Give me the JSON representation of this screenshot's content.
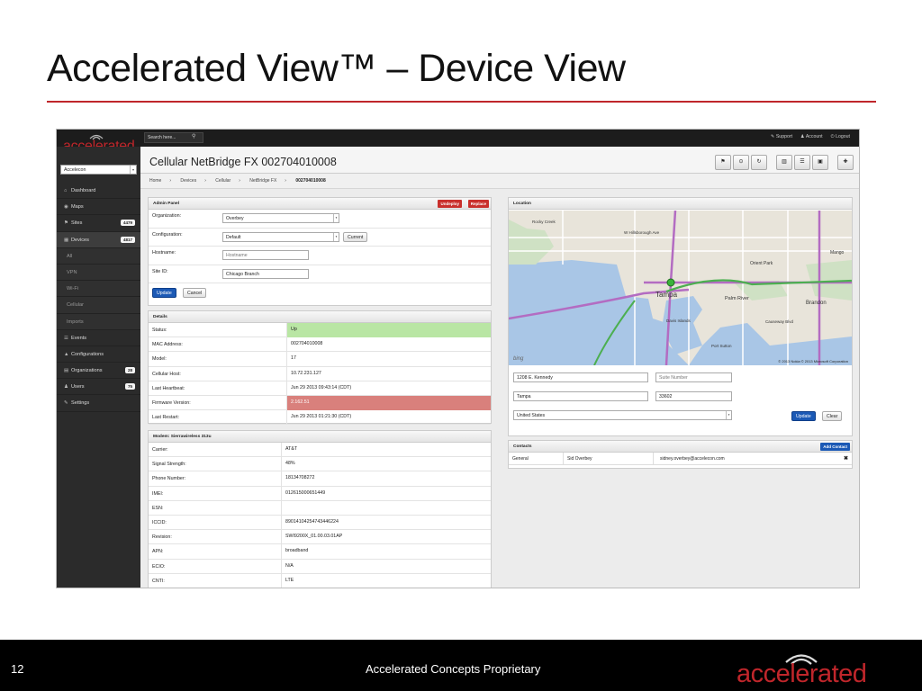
{
  "slide": {
    "title": "Accelerated View™ – Device View",
    "page_number": "12",
    "footer_text": "Accelerated Concepts Proprietary",
    "logo_text": "accelerated",
    "accent_color": "#c0262b"
  },
  "app": {
    "brand": "accelerated",
    "search_placeholder": "Search here...",
    "top_links": [
      "Support",
      "Account",
      "Logout"
    ],
    "org_select": "Accelecon",
    "nav": [
      {
        "label": "Dashboard",
        "icon": "home-icon",
        "glyph": "⌂",
        "badge": ""
      },
      {
        "label": "Maps",
        "icon": "map-pin-icon",
        "glyph": "◉",
        "badge": ""
      },
      {
        "label": "Sites",
        "icon": "flag-icon",
        "glyph": "⚑",
        "badge": "4479"
      },
      {
        "label": "Devices",
        "icon": "device-icon",
        "glyph": "▦",
        "badge": "4817",
        "active": true
      },
      {
        "label": "All",
        "sub": true,
        "badge": ""
      },
      {
        "label": "VPN",
        "sub": true,
        "badge": ""
      },
      {
        "label": "Wi-Fi",
        "sub": true,
        "badge": ""
      },
      {
        "label": "Cellular",
        "sub": true,
        "badge": ""
      },
      {
        "label": "Imports",
        "sub": true,
        "badge": ""
      },
      {
        "label": "Events",
        "icon": "list-icon",
        "glyph": "☰",
        "badge": ""
      },
      {
        "label": "Configurations",
        "icon": "flask-icon",
        "glyph": "▲",
        "badge": ""
      },
      {
        "label": "Organizations",
        "icon": "org-icon",
        "glyph": "▤",
        "badge": "28"
      },
      {
        "label": "Users",
        "icon": "user-icon",
        "glyph": "♟",
        "badge": "75"
      },
      {
        "label": "Settings",
        "icon": "wrench-icon",
        "glyph": "✎",
        "badge": ""
      }
    ],
    "page_title": "Cellular NetBridge FX 002704010008",
    "breadcrumbs": [
      "Home",
      "Devices",
      "Cellular",
      "NetBridge FX",
      "002704010008"
    ],
    "admin": {
      "title": "Admin Panel",
      "undeploy": "Undeploy",
      "replace": "Replace",
      "organization_label": "Organization:",
      "organization_value": "Overbey",
      "configuration_label": "Configuration:",
      "configuration_value": "Default",
      "current_btn": "Current",
      "hostname_label": "Hostname:",
      "hostname_placeholder": "Hostname",
      "siteid_label": "Site ID:",
      "siteid_value": "Chicago Branch",
      "update": "Update",
      "cancel": "Cancel"
    },
    "details": {
      "title": "Details",
      "rows": [
        {
          "k": "Status:",
          "v": "Up",
          "state": "good"
        },
        {
          "k": "MAC Address:",
          "v": "002704010008"
        },
        {
          "k": "Model:",
          "v": "17"
        },
        {
          "k": "Cellular Host:",
          "v": "10.72.231.127"
        },
        {
          "k": "Last Heartbeat:",
          "v": "Jun 29 2013 09:43:14 (CDT)"
        },
        {
          "k": "Firmware Version:",
          "v": "2.162.51",
          "state": "bad"
        },
        {
          "k": "Last Restart:",
          "v": "Jun 29 2013 01:21:30 (CDT)"
        }
      ]
    },
    "modem": {
      "title": "Modem: Sierrawireless 313u",
      "rows": [
        {
          "k": "Carrier:",
          "v": "AT&T"
        },
        {
          "k": "Signal Strength:",
          "v": "48%"
        },
        {
          "k": "Phone Number:",
          "v": "18134708272"
        },
        {
          "k": "IMEI:",
          "v": "012615000651449"
        },
        {
          "k": "ESN:",
          "v": ""
        },
        {
          "k": "ICCID:",
          "v": "89014104254743446224"
        },
        {
          "k": "Revision:",
          "v": "SWI9200X_01.00.03.01AP"
        },
        {
          "k": "APN:",
          "v": "broadband"
        },
        {
          "k": "ECIO:",
          "v": "N/A"
        },
        {
          "k": "CNTI:",
          "v": "LTE"
        }
      ]
    },
    "location": {
      "title": "Location",
      "address": "1208 E. Kennedy",
      "suite_placeholder": "Suite Number",
      "city": "Tampa",
      "zip": "33602",
      "country": "United States",
      "update": "Update",
      "clear": "Clear",
      "map_labels": [
        "Tampa",
        "Orient Park",
        "Brandon",
        "Mango",
        "Palm River",
        "Rocky Creek",
        "W Hillsborough Ave",
        "Davis Islands",
        "Port Sutton",
        "Causeway Blvd"
      ],
      "map_copyright": "© 2013 Nokia   © 2013 Microsoft Corporation",
      "map_provider": "bing"
    },
    "contacts": {
      "title": "Contacts",
      "add": "Add Contact",
      "rows": [
        {
          "type": "General",
          "name": "Sid Overbey",
          "email": "sidney.overbey@accelecon.com"
        }
      ]
    }
  }
}
